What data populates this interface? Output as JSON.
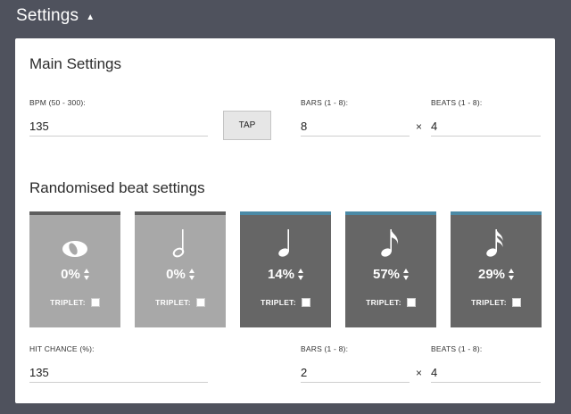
{
  "header": {
    "title": "Settings",
    "caret": "▲"
  },
  "main": {
    "title": "Main Settings",
    "bpm": {
      "label": "BPM (50 - 300):",
      "value": "135"
    },
    "tap_label": "TAP",
    "bars": {
      "label": "BARS (1 - 8):",
      "value": "8"
    },
    "times": "×",
    "beats": {
      "label": "BEATS (1 - 8):",
      "value": "4"
    }
  },
  "random": {
    "title": "Randomised beat settings",
    "tiles": [
      {
        "note": "whole-note-icon",
        "percent": "0%",
        "triplet_label": "TRIPLET:",
        "active": false
      },
      {
        "note": "half-note-icon",
        "percent": "0%",
        "triplet_label": "TRIPLET:",
        "active": false
      },
      {
        "note": "quarter-note-icon",
        "percent": "14%",
        "triplet_label": "TRIPLET:",
        "active": true
      },
      {
        "note": "eighth-note-icon",
        "percent": "57%",
        "triplet_label": "TRIPLET:",
        "active": true
      },
      {
        "note": "sixteenth-note-icon",
        "percent": "29%",
        "triplet_label": "TRIPLET:",
        "active": true
      }
    ],
    "hit_chance": {
      "label": "HIT CHANCE (%):",
      "value": "135"
    },
    "bars": {
      "label": "BARS (1 - 8):",
      "value": "2"
    },
    "times": "×",
    "beats": {
      "label": "BEATS (1 - 8):",
      "value": "4"
    }
  },
  "colors": {
    "background": "#4f525d",
    "tile_off": "#a8a8a8",
    "tile_on": "#666666",
    "active_bar": "#4b8aa6",
    "inactive_bar": "#5e5e5e"
  }
}
